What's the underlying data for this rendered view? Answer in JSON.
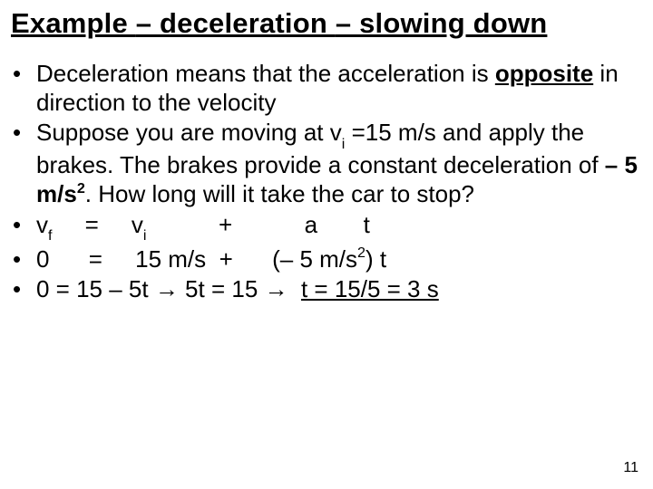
{
  "title_parts": {
    "a": "Example ",
    "b": "– deceleration ",
    "c": "– slowing down"
  },
  "bullet1": {
    "p1": "Deceleration means that the acceleration is ",
    "opposite": "opposite",
    "p2": " in direction to the velocity"
  },
  "bullet2": {
    "p1": "Suppose you are moving at v",
    "sub_i": "i",
    "p2": " =15 m/s and apply the brakes. The brakes provide a constant deceleration of ",
    "bold_a": "–",
    "bold_b": " 5 m/s",
    "sup2": "2",
    "p3": ". How long will it take the car to stop?"
  },
  "bullet3": {
    "p1": "v",
    "sub_f": "f",
    "p2": "     =     v",
    "sub_i": "i",
    "p3": "           +           a       t"
  },
  "bullet4": {
    "p1": "0      =     15 m/s  +      (",
    "minus": "–",
    "p2": " 5 m/s",
    "sup2": "2",
    "p3": ") t"
  },
  "bullet5": {
    "p1": "0 = 15 – 5t ",
    "arrow1": "→",
    "p2": " 5t = 15 ",
    "arrow2": "→",
    "p3": "  ",
    "ans": "t = 15/5 = 3 s"
  },
  "pagenum": "11"
}
